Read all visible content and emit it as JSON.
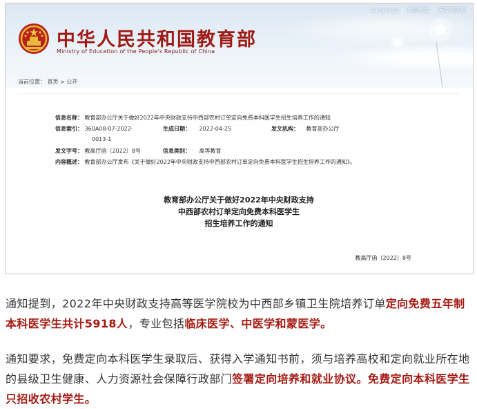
{
  "header": {
    "language": "Language",
    "links": [
      "微言教育",
      "无障碍浏览"
    ],
    "title": "中华人民共和国教育部",
    "subtitle": "Ministry of Education of the People's Republic of China"
  },
  "breadcrumb": "当前位置： 首页 > 公开",
  "meta": {
    "name_label": "信息名称：",
    "name_value": "教育部办公厅关于做好2022年中央财政支持中西部农村订单定向免费本科医学生招生培养工作的通知",
    "index_label": "信息索引：",
    "index_value_1": "360A08-07-2022-",
    "index_value_2": "0013-1",
    "date_label": "生成日期：",
    "date_value": "2022-04-25",
    "org_label": "发文机构：",
    "org_value": "教育部办公厅",
    "docno_label": "发文字号：",
    "docno_value": "教高厅函〔2022〕8号",
    "category_label": "信息类别：",
    "category_value": "高等教育",
    "summary_label": "内容概述：",
    "summary_value": "教育部办公厅发布《关于做好2022年中央财政支持中西部农村订单定向免费本科医学生招生培养工作的通知》。"
  },
  "document": {
    "title_line1": "教育部办公厅关于做好2022年中央财政支持",
    "title_line2": "中西部农村订单定向免费本科医学生",
    "title_line3": "招生培养工作的通知",
    "number": "教高厅函〔2022〕8号"
  },
  "article": {
    "p1_a": "通知提到，2022年中央财政支持高等医学院校为中西部乡镇卫生院培养订单",
    "p1_b": "定向免费五年制本科医学生共计5918人",
    "p1_c": "，专业包括",
    "p1_d": "临床医学、中医学和蒙医学。",
    "p2_a": "通知要求，免费定向本科医学生录取后、获得入学通知书前，须与培养高校和定向就业所在地的县级卫生健康、人力资源社会保障行政部门",
    "p2_b": "签署定向培养和就业协议。免费定向本科医学生只招收农村学生。"
  },
  "colors": {
    "highlight": "#a41a12",
    "title_red": "#9e1a14"
  }
}
